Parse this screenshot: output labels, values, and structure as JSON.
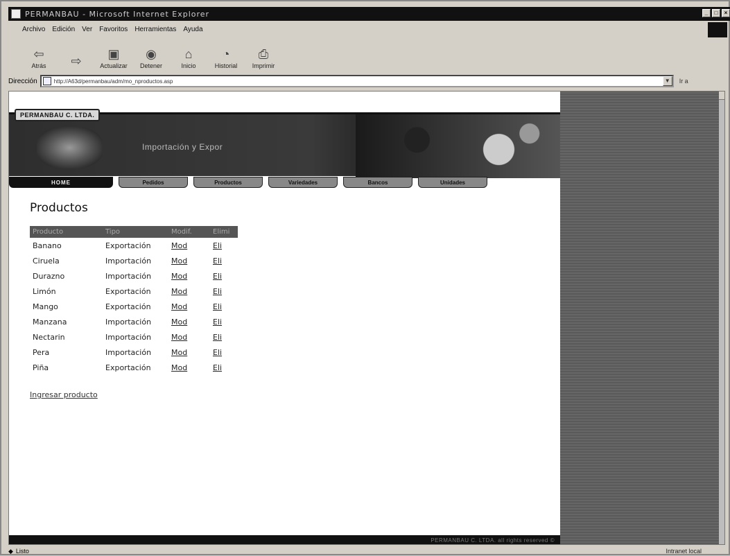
{
  "window": {
    "title": "PERMANBAU - Microsoft Internet Explorer"
  },
  "menu": [
    "Archivo",
    "Edición",
    "Ver",
    "Favoritos",
    "Herramientas",
    "Ayuda"
  ],
  "toolbar": [
    {
      "label": "Atrás",
      "icon": "back-arrow-icon"
    },
    {
      "label": "",
      "icon": "forward-arrow-icon"
    },
    {
      "label": "Actualizar",
      "icon": "refresh-icon"
    },
    {
      "label": "Detener",
      "icon": "stop-icon"
    },
    {
      "label": "Inicio",
      "icon": "home-icon"
    },
    {
      "label": "Historial",
      "icon": "history-icon"
    },
    {
      "label": "Imprimir",
      "icon": "print-icon"
    }
  ],
  "address": {
    "label": "Dirección",
    "url": "http://A63d/permanbau/adm/mo_nproductos.asp",
    "go": "Ir a"
  },
  "site": {
    "brand": "PERMANBAU C. LTDA.",
    "tagline": "Importación y Expor",
    "nav": [
      "HOME",
      "Pedidos",
      "Productos",
      "Variedades",
      "Bancos",
      "Unidades"
    ],
    "footer": "PERMANBAU C. LTDA. all rights reserved ©"
  },
  "content": {
    "page_title": "Productos",
    "columns": [
      "Producto",
      "Tipo",
      "Modif.",
      "Elimi"
    ],
    "rows": [
      {
        "producto": "Banano",
        "tipo": "Exportación",
        "mod": "Mod",
        "eli": "Eli"
      },
      {
        "producto": "Ciruela",
        "tipo": "Importación",
        "mod": "Mod",
        "eli": "Eli"
      },
      {
        "producto": "Durazno",
        "tipo": "Importación",
        "mod": "Mod",
        "eli": "Eli"
      },
      {
        "producto": "Limón",
        "tipo": "Exportación",
        "mod": "Mod",
        "eli": "Eli"
      },
      {
        "producto": "Mango",
        "tipo": "Exportación",
        "mod": "Mod",
        "eli": "Eli"
      },
      {
        "producto": "Manzana",
        "tipo": "Importación",
        "mod": "Mod",
        "eli": "Eli"
      },
      {
        "producto": "Nectarin",
        "tipo": "Importación",
        "mod": "Mod",
        "eli": "Eli"
      },
      {
        "producto": "Pera",
        "tipo": "Importación",
        "mod": "Mod",
        "eli": "Eli"
      },
      {
        "producto": "Piña",
        "tipo": "Exportación",
        "mod": "Mod",
        "eli": "Eli"
      }
    ],
    "add_link": "Ingresar producto"
  },
  "status": {
    "text": "Listo",
    "zone": "Intranet local"
  }
}
